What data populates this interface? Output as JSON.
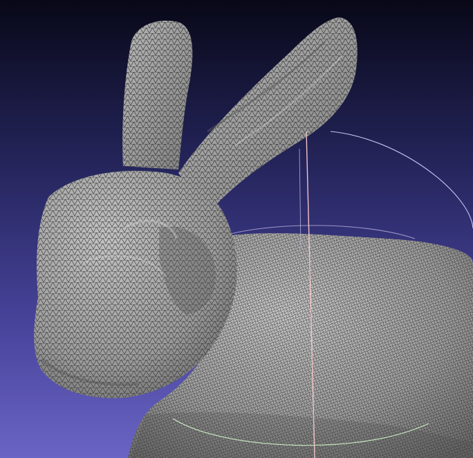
{
  "viewport": {
    "background_top": "#080818",
    "background_bottom": "#6a64c4",
    "mesh_fill": "#9c9c9c",
    "mesh_edge": "#2c2c2c",
    "mesh_highlight": "#c8c8c8",
    "trackball_x_color": "#f2c4c8",
    "trackball_y_color": "#c8e8c0",
    "trackball_z_color": "#c8c4f0"
  },
  "model": {
    "name_icon": "bunny-mesh",
    "render_mode": "wireframe-on-flat"
  },
  "trackball": {
    "icon": "trackball-gizmo",
    "visible": true
  }
}
